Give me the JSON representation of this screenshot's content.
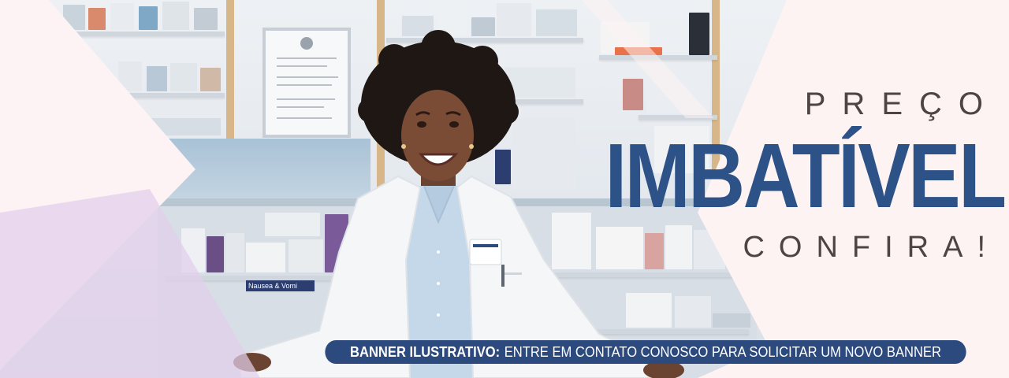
{
  "hero": {
    "kicker": "PREÇO",
    "headline": "IMBATÍVEL",
    "cta": "CONFIRA!"
  },
  "notice": {
    "lead": "BANNER ILUSTRATIVO:",
    "text": "ENTRE EM CONTATO CONOSCO PARA SOLICITAR UM NOVO BANNER"
  },
  "scene": {
    "shelf_tag": "Nausea & Vomi"
  },
  "colors": {
    "headline": "#2d5288",
    "text": "#4e4443",
    "notice_background": "#2d4a7e",
    "overlay": "#fdf3f4"
  }
}
